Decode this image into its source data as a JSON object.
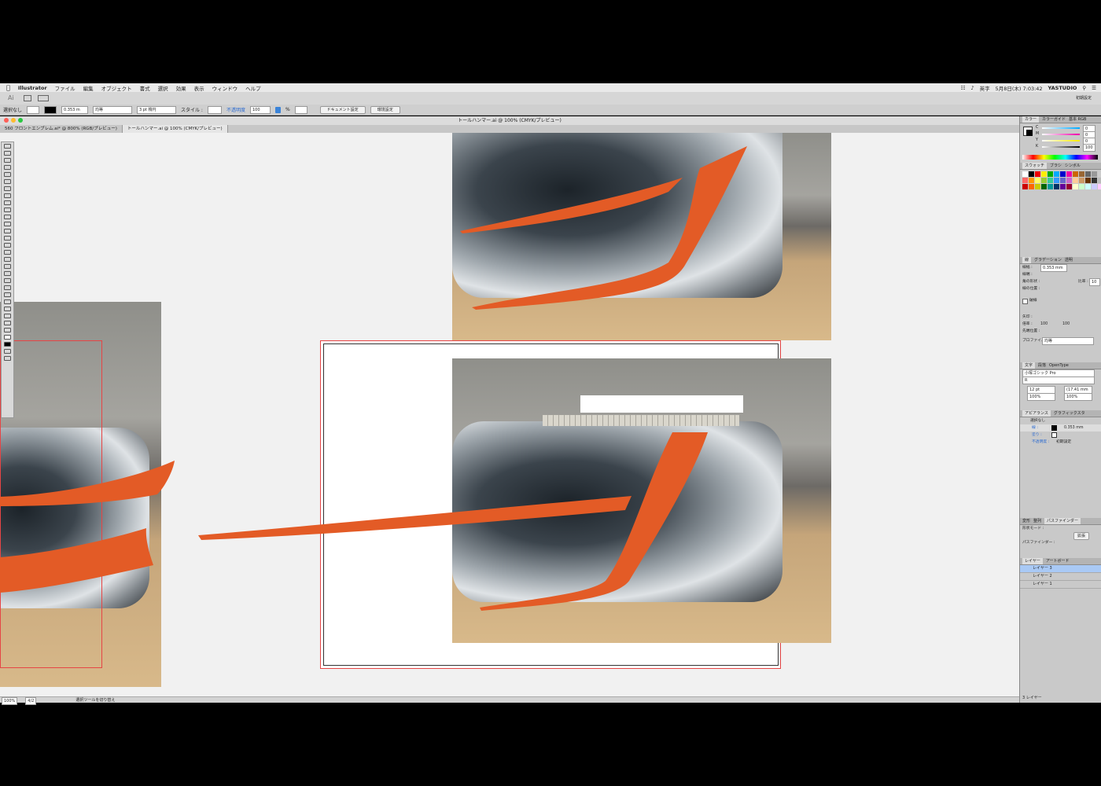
{
  "menubar": {
    "app": "Illustrator",
    "items": [
      "ファイル",
      "編集",
      "オブジェクト",
      "書式",
      "選択",
      "効果",
      "表示",
      "ウィンドウ",
      "ヘルプ"
    ],
    "status_lang": "英字",
    "clock": "5月8日(木) 7:03:42",
    "user": "YASTUDIO"
  },
  "appbar": {
    "workspace": "初期設定"
  },
  "controlbar": {
    "selection": "選択なし",
    "stroke_weight": "0.353 m",
    "stroke_style": "均等",
    "brush": "3 pt 楕円",
    "style_label": "スタイル :",
    "opacity_label": "不透明度",
    "opacity_value": "100",
    "percent": "%",
    "doc_setup": "ドキュメント設定",
    "prefs": "環境設定"
  },
  "window": {
    "title": "トールハンマー.ai @ 100% (CMYK/プレビュー)"
  },
  "tabs": [
    {
      "label": "560 フロントエンブレム.ai* @ 800% (RGB/プレビュー)"
    },
    {
      "label": "トールハンマー.ai @ 100% (CMYK/プレビュー)"
    }
  ],
  "statusbar": {
    "zoom": "100%",
    "artboard": "4/2",
    "tool": "選択ツールを切り替え"
  },
  "panels": {
    "color": {
      "tabs": [
        "カラー",
        "カラーガイド",
        "基本 RGB"
      ],
      "channels": [
        "C",
        "M",
        "Y",
        "K"
      ],
      "values": [
        "0",
        "0",
        "0",
        "100"
      ]
    },
    "swatches": {
      "tabs": [
        "スウォッチ",
        "ブラシ",
        "シンボル"
      ]
    },
    "stroke": {
      "tabs": [
        "線",
        "グラデーション",
        "透明"
      ],
      "weight_label": "線幅 :",
      "weight_value": "0.353 mm",
      "cap_label": "線端 :",
      "corner_label": "角の形状 :",
      "limit_label": "比率 :",
      "limit_value": "10",
      "align_label": "線の位置 :",
      "dashed_label": "破線",
      "arrow_label": "矢印 :",
      "scale_label": "倍率 :",
      "scale_values": [
        "100",
        "100"
      ],
      "align2_label": "先端位置 :",
      "profile_label": "プロファイル :",
      "profile_value": "均等"
    },
    "type": {
      "tabs": [
        "文字",
        "段落",
        "OpenType"
      ],
      "font": "小塚ゴシック Pro",
      "style": "R",
      "size": "12 pt",
      "leading": "(17.41 mm",
      "vscale": "100%",
      "hscale": "100%"
    },
    "appearance": {
      "tabs": [
        "アピアランス",
        "グラフィックスタ"
      ],
      "none": "選択なし",
      "stroke_label": "線 :",
      "stroke_value": "0.353 mm",
      "fill_label": "塗り :",
      "opacity_label": "不透明度 :",
      "opacity_value": "初期設定"
    },
    "pathfinder": {
      "tabs": [
        "変形",
        "整列",
        "パスファインダー"
      ],
      "shape_mode": "形状モード :",
      "expand": "拡張",
      "pf_label": "パスファインダー :"
    },
    "layers": {
      "tabs": [
        "レイヤー",
        "アートボード"
      ],
      "items": [
        "レイヤー 3",
        "レイヤー 2",
        "レイヤー 1"
      ],
      "count": "3 レイヤー"
    }
  },
  "colors": {
    "accent": "#e35b26",
    "artboard_border": "#e64545",
    "selection": "#3a83d8"
  }
}
